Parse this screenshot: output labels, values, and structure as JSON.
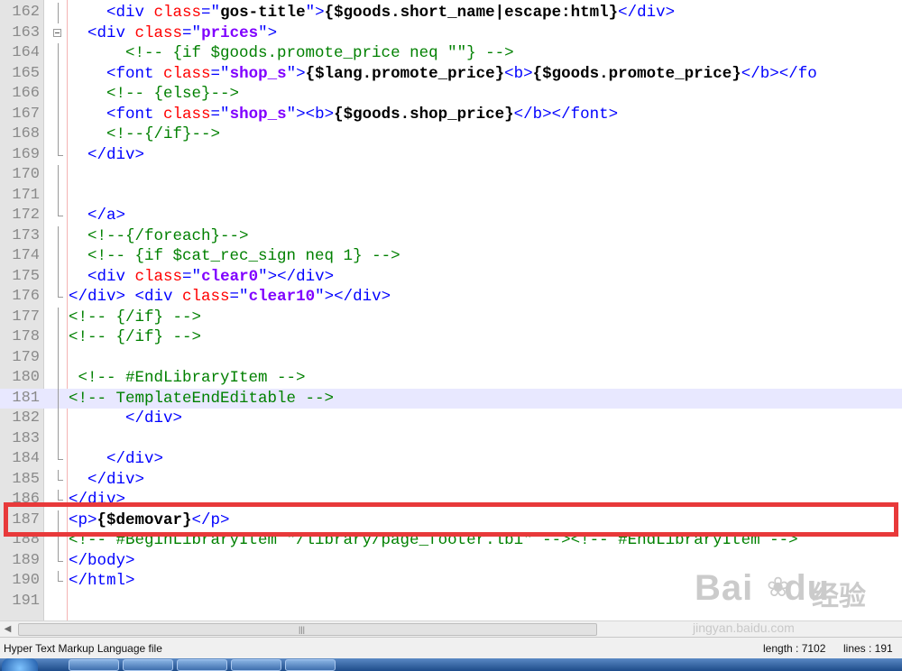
{
  "editor": {
    "lines": [
      {
        "num": "162",
        "fold": "vl",
        "segs": [
          [
            "n",
            "    "
          ],
          [
            "t",
            "<div "
          ],
          [
            "a",
            "class"
          ],
          [
            "t",
            "=\""
          ],
          [
            "b",
            "gos-title"
          ],
          [
            "t",
            "\">"
          ],
          [
            "b",
            "{$goods.short_name|escape:html}"
          ],
          [
            "t",
            "</div>"
          ]
        ]
      },
      {
        "num": "163",
        "fold": "box",
        "segs": [
          [
            "n",
            "  "
          ],
          [
            "t",
            "<div "
          ],
          [
            "a",
            "class"
          ],
          [
            "t",
            "=\""
          ],
          [
            "v",
            "prices"
          ],
          [
            "t",
            "\">"
          ]
        ]
      },
      {
        "num": "164",
        "fold": "vl",
        "segs": [
          [
            "n",
            "      "
          ],
          [
            "c",
            "<!-- {if $goods.promote_price neq \"\"} -->"
          ]
        ]
      },
      {
        "num": "165",
        "fold": "vl",
        "segs": [
          [
            "n",
            "    "
          ],
          [
            "t",
            "<font "
          ],
          [
            "a",
            "class"
          ],
          [
            "t",
            "=\""
          ],
          [
            "v",
            "shop_s"
          ],
          [
            "t",
            "\">"
          ],
          [
            "b",
            "{$lang.promote_price}"
          ],
          [
            "t",
            "<b>"
          ],
          [
            "b",
            "{$goods.promote_price}"
          ],
          [
            "t",
            "</b></fo"
          ]
        ]
      },
      {
        "num": "166",
        "fold": "vl",
        "segs": [
          [
            "n",
            "    "
          ],
          [
            "c",
            "<!-- {else}-->"
          ]
        ]
      },
      {
        "num": "167",
        "fold": "vl",
        "segs": [
          [
            "n",
            "    "
          ],
          [
            "t",
            "<font "
          ],
          [
            "a",
            "class"
          ],
          [
            "t",
            "=\""
          ],
          [
            "v",
            "shop_s"
          ],
          [
            "t",
            "\"><b>"
          ],
          [
            "b",
            "{$goods.shop_price}"
          ],
          [
            "t",
            "</b></font>"
          ]
        ]
      },
      {
        "num": "168",
        "fold": "vl",
        "segs": [
          [
            "n",
            "    "
          ],
          [
            "c",
            "<!--{/if}-->"
          ]
        ]
      },
      {
        "num": "169",
        "fold": "end",
        "segs": [
          [
            "n",
            "  "
          ],
          [
            "t",
            "</div>"
          ]
        ]
      },
      {
        "num": "170",
        "fold": "vl",
        "segs": []
      },
      {
        "num": "171",
        "fold": "vl",
        "segs": []
      },
      {
        "num": "172",
        "fold": "end",
        "segs": [
          [
            "n",
            "  "
          ],
          [
            "t",
            "</a>"
          ]
        ]
      },
      {
        "num": "173",
        "fold": "vl",
        "segs": [
          [
            "n",
            "  "
          ],
          [
            "c",
            "<!--{/foreach}-->"
          ]
        ]
      },
      {
        "num": "174",
        "fold": "vl",
        "segs": [
          [
            "n",
            "  "
          ],
          [
            "c",
            "<!-- {if $cat_rec_sign neq 1} -->"
          ]
        ]
      },
      {
        "num": "175",
        "fold": "vl",
        "segs": [
          [
            "n",
            "  "
          ],
          [
            "t",
            "<div "
          ],
          [
            "a",
            "class"
          ],
          [
            "t",
            "=\""
          ],
          [
            "v",
            "clear0"
          ],
          [
            "t",
            "\"></div>"
          ]
        ]
      },
      {
        "num": "176",
        "fold": "end",
        "segs": [
          [
            "t",
            "</div> <div "
          ],
          [
            "a",
            "class"
          ],
          [
            "t",
            "=\""
          ],
          [
            "v",
            "clear10"
          ],
          [
            "t",
            "\"></div>"
          ]
        ]
      },
      {
        "num": "177",
        "fold": "vl",
        "segs": [
          [
            "c",
            "<!-- {/if} -->"
          ]
        ]
      },
      {
        "num": "178",
        "fold": "vl",
        "segs": [
          [
            "c",
            "<!-- {/if} -->"
          ]
        ]
      },
      {
        "num": "179",
        "fold": "vl",
        "segs": []
      },
      {
        "num": "180",
        "fold": "vl",
        "segs": [
          [
            "n",
            " "
          ],
          [
            "c",
            "<!-- #EndLibraryItem -->"
          ]
        ]
      },
      {
        "num": "181",
        "fold": "vl",
        "cur": true,
        "segs": [
          [
            "c",
            "<!-- TemplateEndEditable -->"
          ]
        ]
      },
      {
        "num": "182",
        "fold": "vl",
        "segs": [
          [
            "n",
            "      "
          ],
          [
            "t",
            "</div>"
          ]
        ]
      },
      {
        "num": "183",
        "fold": "vl",
        "segs": []
      },
      {
        "num": "184",
        "fold": "end",
        "segs": [
          [
            "n",
            "    "
          ],
          [
            "t",
            "</div>"
          ]
        ]
      },
      {
        "num": "185",
        "fold": "end",
        "segs": [
          [
            "n",
            "  "
          ],
          [
            "t",
            "</div>"
          ]
        ]
      },
      {
        "num": "186",
        "fold": "end",
        "segs": [
          [
            "t",
            "</div>"
          ]
        ]
      },
      {
        "num": "187",
        "fold": "vl",
        "segs": [
          [
            "t",
            "<p>"
          ],
          [
            "b",
            "{$demovar}"
          ],
          [
            "t",
            "</p>"
          ]
        ]
      },
      {
        "num": "188",
        "fold": "vl",
        "segs": [
          [
            "c",
            "<!-- #BeginLibraryItem \"/library/page_footer.lbi\" --><!-- #EndLibraryItem -->"
          ]
        ]
      },
      {
        "num": "189",
        "fold": "end",
        "segs": [
          [
            "t",
            "</body>"
          ]
        ]
      },
      {
        "num": "190",
        "fold": "end",
        "segs": [
          [
            "t",
            "</html>"
          ]
        ]
      },
      {
        "num": "191",
        "fold": "",
        "segs": []
      }
    ]
  },
  "status": {
    "file_type": "Hyper Text Markup Language file",
    "length": "length : 7102",
    "lines": "lines : 191"
  },
  "watermark": {
    "logo": "Bai",
    "paw": "❀",
    "logo_suffix": "du",
    "cn": "经验",
    "url": "jingyan.baidu.com"
  },
  "colors": {
    "highlight": "#e8393a",
    "tag": "#0000ff",
    "attribute": "#ff0000",
    "comment": "#008000"
  }
}
